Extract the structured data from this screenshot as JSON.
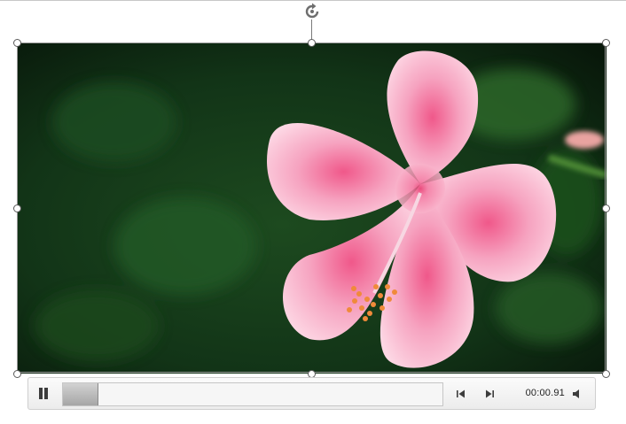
{
  "player": {
    "current_time": "00:00.91",
    "progress": 0.09,
    "state": "playing",
    "icons": {
      "rotate": "rotate-icon",
      "pause": "pause-icon",
      "back": "step-back-icon",
      "forward": "step-forward-icon",
      "volume": "volume-icon"
    }
  },
  "media": {
    "subject": "pink-hibiscus-flower",
    "colors": {
      "petal": "#f5a9c4",
      "background": "#0f2a12"
    }
  }
}
